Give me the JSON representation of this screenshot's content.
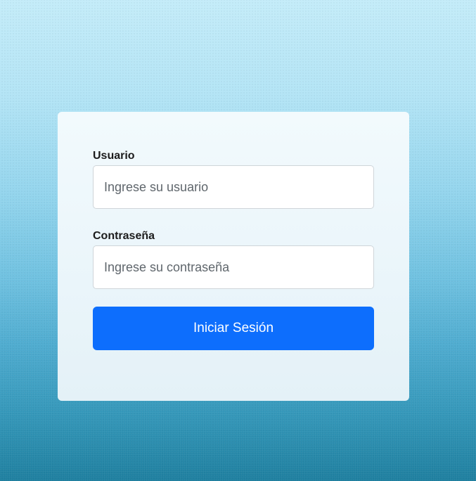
{
  "login_form": {
    "username": {
      "label": "Usuario",
      "value": "",
      "placeholder": "Ingrese su usuario"
    },
    "password": {
      "label": "Contraseña",
      "value": "",
      "placeholder": "Ingrese su contraseña"
    },
    "submit_label": "Iniciar Sesión"
  },
  "colors": {
    "button": "#0d6efd",
    "background_top": "#c4ecf9",
    "background_bottom": "#1e7f9f",
    "card": "#eef8fc"
  }
}
